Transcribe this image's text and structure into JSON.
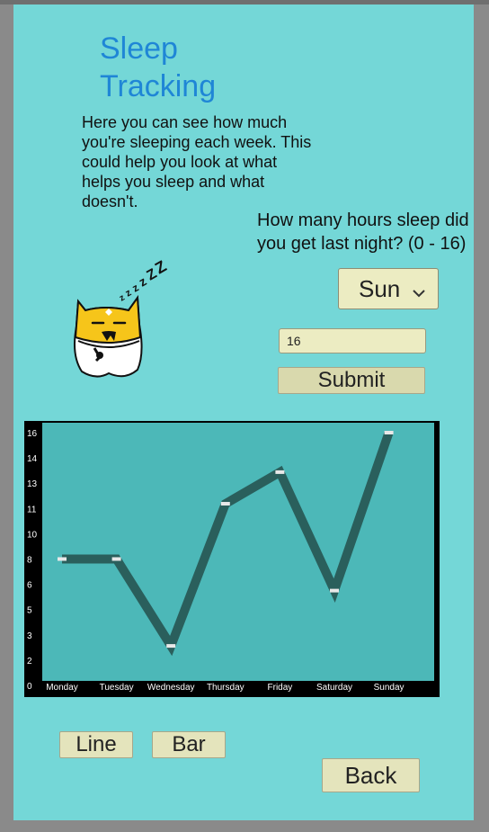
{
  "title": "Sleep Tracking",
  "description": "Here you can see how much you're sleeping each week. This could help you look at what helps you sleep and what doesn't.",
  "question": "How many hours sleep did you get last night? (0 - 16)",
  "day_select": {
    "value": "Sun"
  },
  "hours_input": {
    "value": "16"
  },
  "submit_label": "Submit",
  "view_buttons": {
    "line_label": "Line",
    "bar_label": "Bar"
  },
  "back_label": "Back",
  "mascot": {
    "sleep_text": "zzzzZZ"
  },
  "chart_data": {
    "type": "line",
    "categories": [
      "Monday",
      "Tuesday",
      "Wednesday",
      "Thursday",
      "Friday",
      "Saturday",
      "Sunday"
    ],
    "values": [
      8,
      8,
      2.5,
      11.5,
      13.5,
      6,
      16
    ],
    "y_ticks": [
      "0",
      "2",
      "3",
      "5",
      "6",
      "8",
      "10",
      "11",
      "13",
      "14",
      "16"
    ],
    "ylim": [
      0,
      16
    ],
    "grid": false,
    "colors": {
      "plot_bg": "#4cb8b8",
      "line": "#2a5f5c",
      "frame": "#000000"
    }
  }
}
